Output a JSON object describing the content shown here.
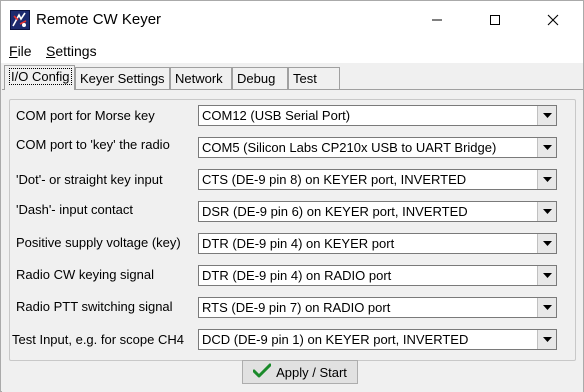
{
  "window": {
    "title": "Remote CW Keyer"
  },
  "icons": {
    "app": "keyer-app-icon",
    "minimize": "minimize-icon",
    "maximize": "maximize-icon",
    "close": "close-icon",
    "dropdown": "chevron-down-icon",
    "apply": "checkmark-icon"
  },
  "menu": {
    "file": "File",
    "settings": "Settings"
  },
  "tabs": [
    {
      "label": "I/O Config",
      "active": true
    },
    {
      "label": "Keyer Settings",
      "active": false
    },
    {
      "label": "Network",
      "active": false
    },
    {
      "label": "Debug",
      "active": false
    },
    {
      "label": "Test",
      "active": false
    }
  ],
  "io_config": {
    "rows": [
      {
        "label": "COM port for Morse key",
        "value": "COM12 (USB Serial Port)"
      },
      {
        "label": "COM port to 'key' the radio",
        "value": "COM5 (Silicon Labs CP210x USB to UART Bridge)"
      },
      {
        "label": "'Dot'- or straight key input",
        "value": "CTS (DE-9 pin 8) on KEYER port, INVERTED"
      },
      {
        "label": "'Dash'-  input contact",
        "value": "DSR (DE-9 pin 6) on KEYER port, INVERTED"
      },
      {
        "label": "Positive supply voltage (key)",
        "value": "DTR (DE-9 pin 4) on KEYER port"
      },
      {
        "label": "Radio CW keying signal",
        "value": "DTR (DE-9 pin 4) on RADIO port"
      },
      {
        "label": "Radio PTT switching signal",
        "value": "RTS (DE-9 pin 7) on RADIO port"
      },
      {
        "label": "Test Input, e.g. for scope CH4",
        "value": "DCD (DE-9 pin 1) on KEYER port, INVERTED"
      }
    ],
    "apply_label": "Apply / Start"
  },
  "colors": {
    "apply_check": "#1a8a2a",
    "titlebar_bg": "#ffffff",
    "panel_bg": "#f0f0f0"
  }
}
